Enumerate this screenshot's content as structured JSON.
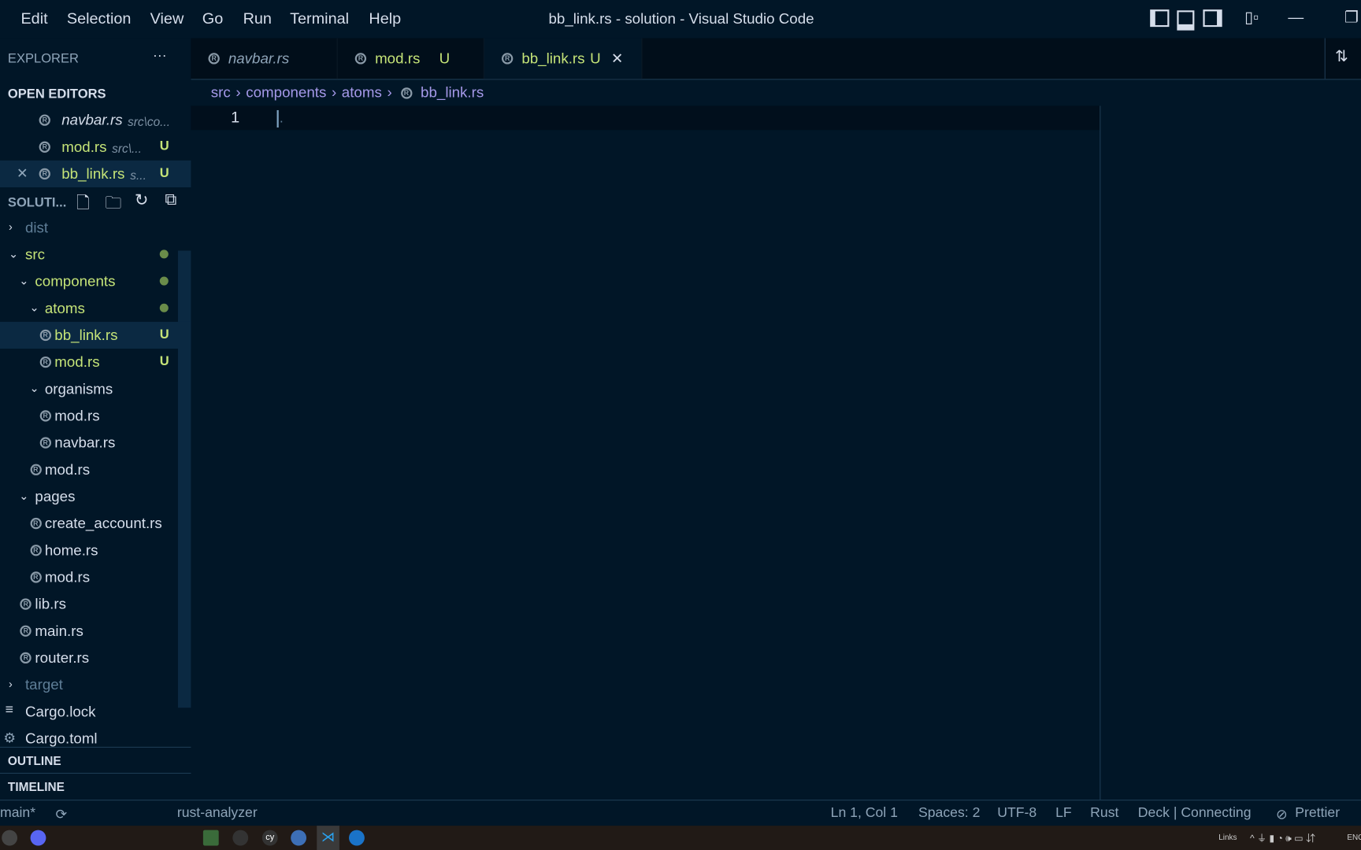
{
  "menu": [
    "Edit",
    "Selection",
    "View",
    "Go",
    "Run",
    "Terminal",
    "Help"
  ],
  "window_title": "bb_link.rs - solution - Visual Studio Code",
  "explorer": {
    "title": "EXPLORER",
    "more": "···",
    "open_editors_label": "OPEN EDITORS",
    "solution_label": "SOLUTI...",
    "open_editors": [
      {
        "name": "navbar.rs",
        "path": "src\\co...",
        "italic": true,
        "color": "#d6deeb",
        "badge": ""
      },
      {
        "name": "mod.rs",
        "path": "src\\...",
        "italic": false,
        "color": "#c5e478",
        "badge": "U"
      },
      {
        "name": "bb_link.rs",
        "path": "s...",
        "italic": false,
        "color": "#c5e478",
        "badge": "U",
        "active": true
      }
    ],
    "tree": [
      {
        "name": "dist",
        "level": 0,
        "type": "folder",
        "open": false,
        "color": "#5f7e97"
      },
      {
        "name": "src",
        "level": 0,
        "type": "folder",
        "open": true,
        "color": "#c5e478",
        "dot": true
      },
      {
        "name": "components",
        "level": 1,
        "type": "folder",
        "open": true,
        "color": "#c5e478",
        "dot": true
      },
      {
        "name": "atoms",
        "level": 2,
        "type": "folder",
        "open": true,
        "color": "#c5e478",
        "dot": true
      },
      {
        "name": "bb_link.rs",
        "level": 3,
        "type": "rs",
        "color": "#c5e478",
        "badge": "U",
        "selected": true
      },
      {
        "name": "mod.rs",
        "level": 3,
        "type": "rs",
        "color": "#c5e478",
        "badge": "U"
      },
      {
        "name": "organisms",
        "level": 2,
        "type": "folder",
        "open": true,
        "color": "#d6deeb"
      },
      {
        "name": "mod.rs",
        "level": 3,
        "type": "rs",
        "color": "#d6deeb"
      },
      {
        "name": "navbar.rs",
        "level": 3,
        "type": "rs",
        "color": "#d6deeb"
      },
      {
        "name": "mod.rs",
        "level": 2,
        "type": "rs",
        "color": "#d6deeb"
      },
      {
        "name": "pages",
        "level": 1,
        "type": "folder",
        "open": true,
        "color": "#d6deeb"
      },
      {
        "name": "create_account.rs",
        "level": 2,
        "type": "rs",
        "color": "#d6deeb"
      },
      {
        "name": "home.rs",
        "level": 2,
        "type": "rs",
        "color": "#d6deeb"
      },
      {
        "name": "mod.rs",
        "level": 2,
        "type": "rs",
        "color": "#d6deeb"
      },
      {
        "name": "lib.rs",
        "level": 1,
        "type": "rs",
        "color": "#d6deeb"
      },
      {
        "name": "main.rs",
        "level": 1,
        "type": "rs",
        "color": "#d6deeb"
      },
      {
        "name": "router.rs",
        "level": 1,
        "type": "rs",
        "color": "#d6deeb"
      },
      {
        "name": "target",
        "level": 0,
        "type": "folder",
        "open": false,
        "color": "#5f7e97"
      },
      {
        "name": "Cargo.lock",
        "level": 0,
        "type": "lock",
        "color": "#d6deeb"
      },
      {
        "name": "Cargo.toml",
        "level": 0,
        "type": "gear",
        "color": "#d6deeb"
      }
    ],
    "outline": "OUTLINE",
    "timeline": "TIMELINE"
  },
  "tabs": [
    {
      "name": "navbar.rs",
      "badge": "",
      "italic": true
    },
    {
      "name": "mod.rs",
      "badge": "U"
    },
    {
      "name": "bb_link.rs",
      "badge": "U",
      "active": true,
      "close": "✕"
    }
  ],
  "breadcrumb": [
    "src",
    "components",
    "atoms",
    "bb_link.rs"
  ],
  "editor": {
    "line_number": "1",
    "content": "."
  },
  "status": {
    "branch": "main*",
    "lsp": "rust-analyzer",
    "position": "Ln 1, Col 1",
    "spaces": "Spaces: 2",
    "encoding": "UTF-8",
    "eol": "LF",
    "language": "Rust",
    "deck": "Deck | Connecting",
    "prettier": "Prettier"
  },
  "taskbar": {
    "tray_text": "Links",
    "lang": "ENG"
  },
  "colors": {
    "bg": "#011627",
    "added": "#c5e478",
    "breadcrumb": "#a599e9",
    "selection": "#0b2942"
  }
}
